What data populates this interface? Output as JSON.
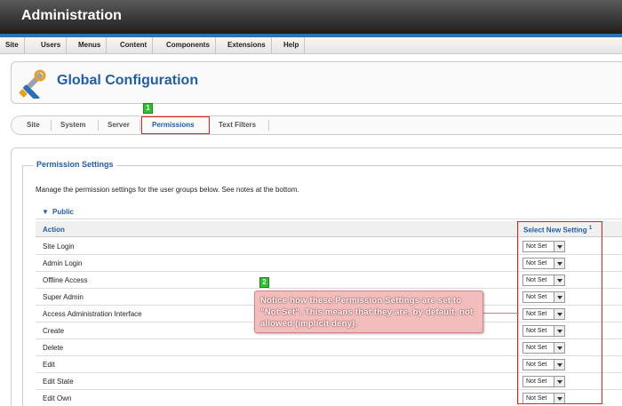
{
  "app": {
    "title": "Administration"
  },
  "menu": [
    {
      "label": "Site"
    },
    {
      "label": "Users"
    },
    {
      "label": "Menus"
    },
    {
      "label": "Content"
    },
    {
      "label": "Components"
    },
    {
      "label": "Extensions"
    },
    {
      "label": "Help"
    }
  ],
  "page": {
    "title": "Global Configuration",
    "icon": "tools-icon"
  },
  "tabs": [
    {
      "label": "Site"
    },
    {
      "label": "System"
    },
    {
      "label": "Server"
    },
    {
      "label": "Permissions"
    },
    {
      "label": "Text Filters"
    }
  ],
  "active_tab": "Permissions",
  "permissions": {
    "legend": "Permission Settings",
    "description": "Manage the permission settings for the user groups below. See notes at the bottom.",
    "group": "Public",
    "columns": {
      "action": "Action",
      "setting": "Select New Setting",
      "setting_note": "1"
    },
    "rows": [
      {
        "action": "Site Login",
        "setting": "Not Set"
      },
      {
        "action": "Admin Login",
        "setting": "Not Set"
      },
      {
        "action": "Offline Access",
        "setting": "Not Set"
      },
      {
        "action": "Super Admin",
        "setting": "Not Set"
      },
      {
        "action": "Access Administration Interface",
        "setting": "Not Set"
      },
      {
        "action": "Create",
        "setting": "Not Set"
      },
      {
        "action": "Delete",
        "setting": "Not Set"
      },
      {
        "action": "Edit",
        "setting": "Not Set"
      },
      {
        "action": "Edit State",
        "setting": "Not Set"
      },
      {
        "action": "Edit Own",
        "setting": "Not Set"
      }
    ]
  },
  "annotations": {
    "badge1": "1",
    "badge2": "2",
    "callout": "Notice how these Permission Settings are set to \"Not Set\". This means that they are, by default, not allowed (implicit deny).",
    "highlight_color": "#e02020",
    "badge_color": "#2fbf2f"
  }
}
